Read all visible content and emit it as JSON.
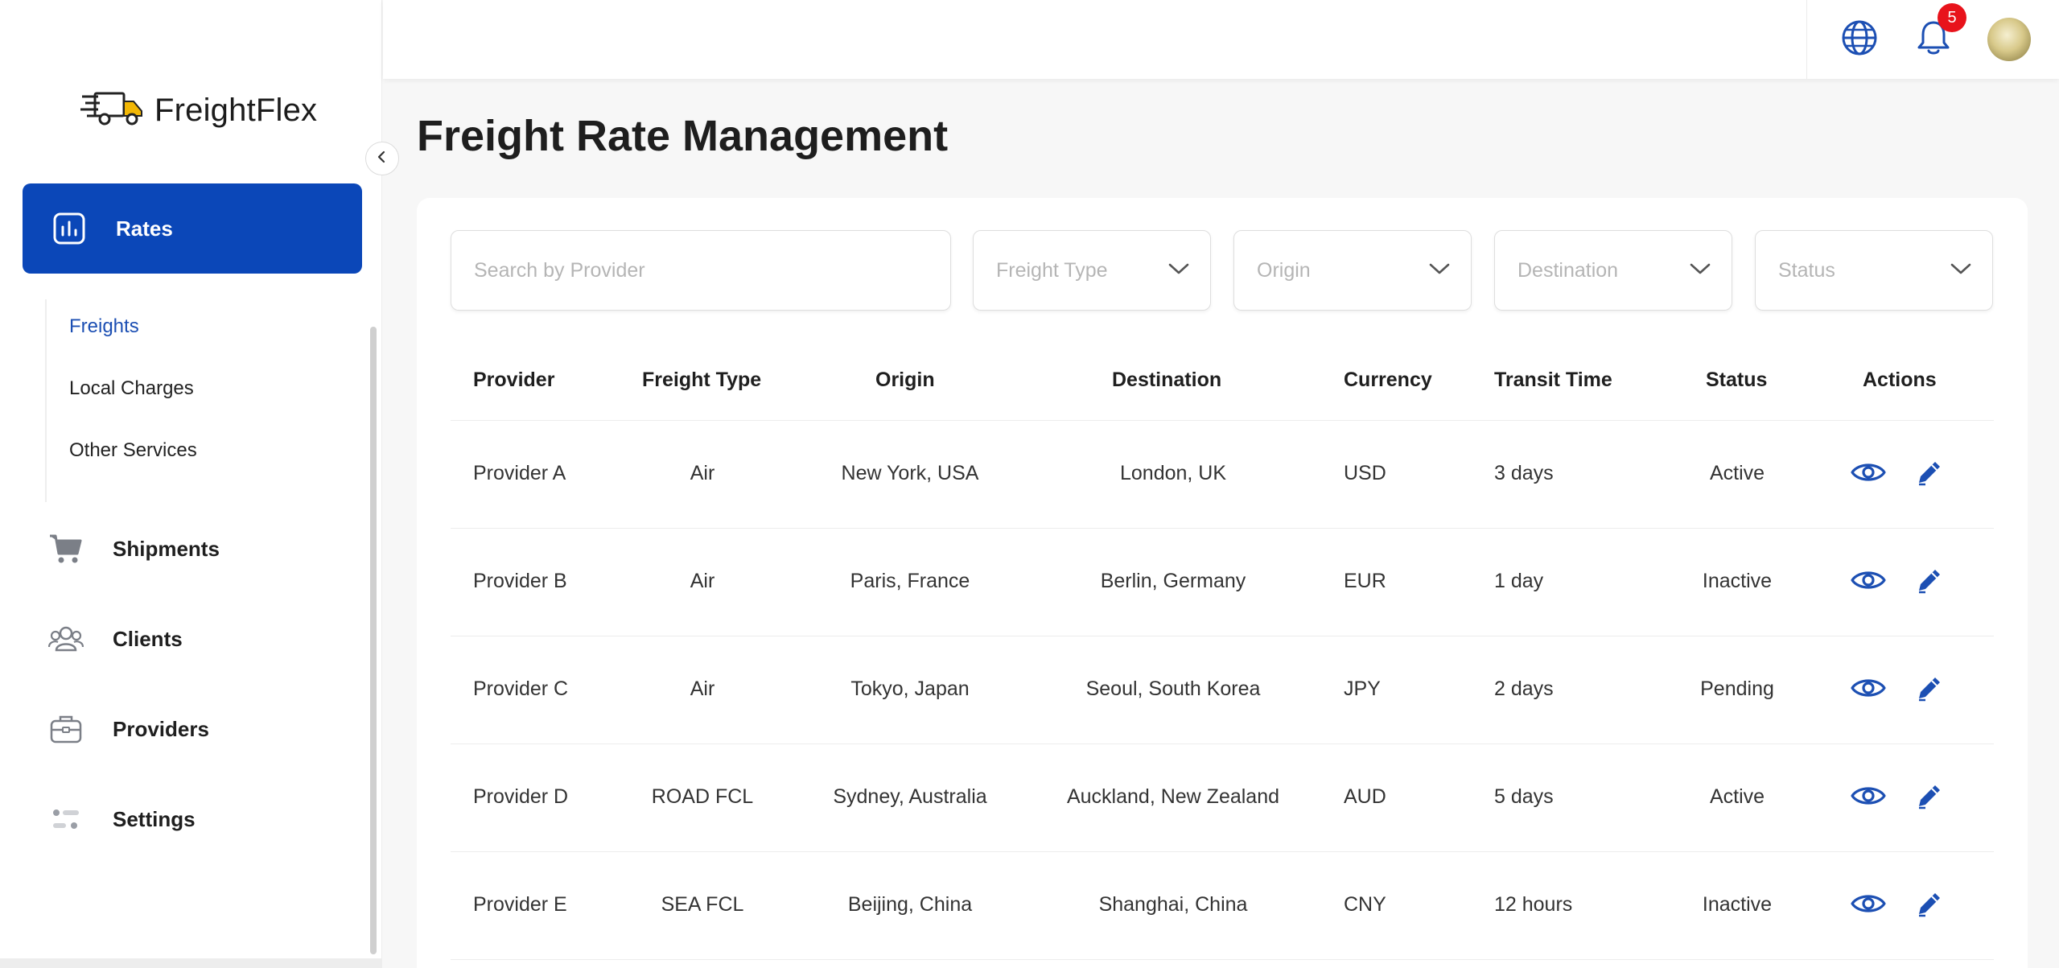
{
  "app": {
    "name": "FreightFlex"
  },
  "sidebar": {
    "active_item": "Rates",
    "sub_items": [
      "Freights",
      "Local Charges",
      "Other Services"
    ],
    "items": [
      {
        "label": "Shipments",
        "icon": "cart-icon"
      },
      {
        "label": "Clients",
        "icon": "users-icon"
      },
      {
        "label": "Providers",
        "icon": "briefcase-icon"
      },
      {
        "label": "Settings",
        "icon": "settings-toggle-icon"
      }
    ]
  },
  "topbar": {
    "notification_count": "5"
  },
  "page": {
    "title": "Freight Rate Management"
  },
  "filters": {
    "search_placeholder": "Search by Provider",
    "freight_type": "Freight Type",
    "origin": "Origin",
    "destination": "Destination",
    "status": "Status"
  },
  "table": {
    "headers": [
      "Provider",
      "Freight Type",
      "Origin",
      "Destination",
      "Currency",
      "Transit Time",
      "Status",
      "Actions"
    ],
    "rows": [
      [
        "Provider A",
        "Air",
        "New York, USA",
        "London, UK",
        "USD",
        "3 days",
        "Active"
      ],
      [
        "Provider B",
        "Air",
        "Paris, France",
        "Berlin, Germany",
        "EUR",
        "1 day",
        "Inactive"
      ],
      [
        "Provider C",
        "Air",
        "Tokyo, Japan",
        "Seoul, South Korea",
        "JPY",
        "2 days",
        "Pending"
      ],
      [
        "Provider D",
        "ROAD FCL",
        "Sydney, Australia",
        "Auckland, New Zealand",
        "AUD",
        "5 days",
        "Active"
      ],
      [
        "Provider E",
        "SEA FCL",
        "Beijing, China",
        "Shanghai, China",
        "CNY",
        "12 hours",
        "Inactive"
      ]
    ]
  },
  "colors": {
    "primary": "#0b47b8",
    "icon_blue": "#1c4fb3",
    "badge": "#e8131b"
  }
}
